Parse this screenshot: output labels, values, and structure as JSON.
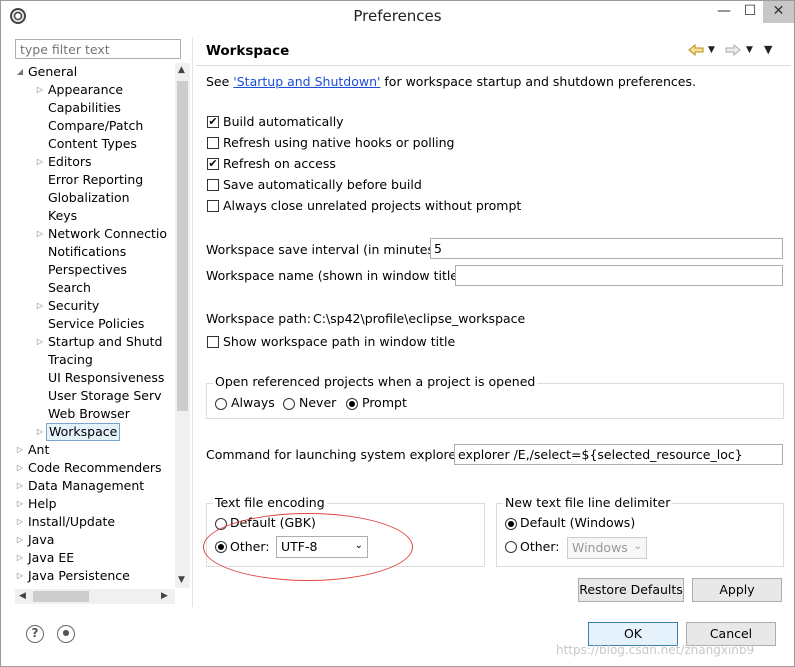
{
  "window": {
    "title": "Preferences",
    "min_glyph": "—",
    "max_glyph": "☐",
    "close_glyph": "✕"
  },
  "left": {
    "filter_placeholder": "type filter text",
    "tree": [
      {
        "label": "General",
        "level": 0,
        "arrow": "open"
      },
      {
        "label": "Appearance",
        "level": 1,
        "arrow": "closed"
      },
      {
        "label": "Capabilities",
        "level": 1,
        "arrow": "none"
      },
      {
        "label": "Compare/Patch",
        "level": 1,
        "arrow": "none"
      },
      {
        "label": "Content Types",
        "level": 1,
        "arrow": "none"
      },
      {
        "label": "Editors",
        "level": 1,
        "arrow": "closed"
      },
      {
        "label": "Error Reporting",
        "level": 1,
        "arrow": "none"
      },
      {
        "label": "Globalization",
        "level": 1,
        "arrow": "none"
      },
      {
        "label": "Keys",
        "level": 1,
        "arrow": "none"
      },
      {
        "label": "Network Connectio",
        "level": 1,
        "arrow": "closed"
      },
      {
        "label": "Notifications",
        "level": 1,
        "arrow": "none"
      },
      {
        "label": "Perspectives",
        "level": 1,
        "arrow": "none"
      },
      {
        "label": "Search",
        "level": 1,
        "arrow": "none"
      },
      {
        "label": "Security",
        "level": 1,
        "arrow": "closed"
      },
      {
        "label": "Service Policies",
        "level": 1,
        "arrow": "none"
      },
      {
        "label": "Startup and Shutd",
        "level": 1,
        "arrow": "closed"
      },
      {
        "label": "Tracing",
        "level": 1,
        "arrow": "none"
      },
      {
        "label": "UI Responsiveness",
        "level": 1,
        "arrow": "none"
      },
      {
        "label": "User Storage Serv",
        "level": 1,
        "arrow": "none"
      },
      {
        "label": "Web Browser",
        "level": 1,
        "arrow": "none"
      },
      {
        "label": "Workspace",
        "level": 1,
        "arrow": "closed",
        "selected": true
      },
      {
        "label": "Ant",
        "level": 0,
        "arrow": "closed"
      },
      {
        "label": "Code Recommenders",
        "level": 0,
        "arrow": "closed"
      },
      {
        "label": "Data Management",
        "level": 0,
        "arrow": "closed"
      },
      {
        "label": "Help",
        "level": 0,
        "arrow": "closed"
      },
      {
        "label": "Install/Update",
        "level": 0,
        "arrow": "closed"
      },
      {
        "label": "Java",
        "level": 0,
        "arrow": "closed"
      },
      {
        "label": "Java EE",
        "level": 0,
        "arrow": "closed"
      },
      {
        "label": "Java Persistence",
        "level": 0,
        "arrow": "closed"
      }
    ]
  },
  "page": {
    "title": "Workspace",
    "see_prefix": "See ",
    "see_link": "'Startup and Shutdown'",
    "see_suffix": " for workspace startup and shutdown preferences.",
    "checkboxes": [
      {
        "label": "Build automatically",
        "checked": true
      },
      {
        "label": "Refresh using native hooks or polling",
        "checked": false
      },
      {
        "label": "Refresh on access",
        "checked": true
      },
      {
        "label": "Save automatically before build",
        "checked": false
      },
      {
        "label": "Always close unrelated projects without prompt",
        "checked": false
      }
    ],
    "save_interval_label": "Workspace save interval (in minutes):",
    "save_interval_value": "5",
    "ws_name_label": "Workspace name (shown in window title):",
    "ws_name_value": "",
    "ws_path_label": "Workspace path:",
    "ws_path_value": "C:\\sp42\\profile\\eclipse_workspace",
    "show_path_label": "Show workspace path in window title",
    "open_group": {
      "legend": "Open referenced projects when a project is opened",
      "options": [
        "Always",
        "Never",
        "Prompt"
      ],
      "selected": "Prompt"
    },
    "cmd_label": "Command for launching system explorer:",
    "cmd_value": "explorer /E,/select=${selected_resource_loc}",
    "encoding": {
      "legend": "Text file encoding",
      "default_label": "Default (GBK)",
      "other_label": "Other:",
      "other_value": "UTF-8",
      "selected": "Other"
    },
    "delimiter": {
      "legend": "New text file line delimiter",
      "default_label": "Default (Windows)",
      "other_label": "Other:",
      "other_value": "Windows",
      "selected": "Default"
    },
    "restore_label": "Restore Defaults",
    "apply_label": "Apply"
  },
  "footer": {
    "help_glyph": "?",
    "ok_label": "OK",
    "cancel_label": "Cancel"
  },
  "watermark": "https://blog.csdn.net/zhangxinb9"
}
